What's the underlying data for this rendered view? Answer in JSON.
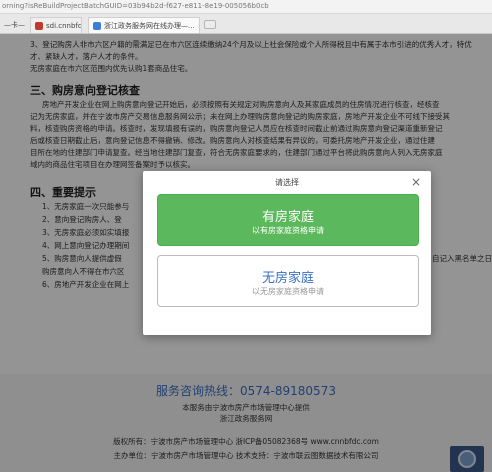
{
  "browser": {
    "url": "orning?isReBuildProjectBatchGUID=03b94b2d-f627-e811-8e19-005056b0cb",
    "tabs": [
      {
        "label": "—卡—"
      },
      {
        "label": "sdi.cnnbfdc.com"
      },
      {
        "label": "浙江政务服务网在线办理—..."
      }
    ]
  },
  "content": {
    "para_lines": [
      "3、登记购房人非市六区户籍的需满足已在市六区连续缴纳24个月及以上社会保险或个人所得税且中有属于本市引进的优秀人才，特优",
      "才、紧缺人才，落户人才的条件。",
      "无房家庭在市六区范围内优先认购1套商品住宅。"
    ],
    "section3_title": "三、购房意向登记核查",
    "section3_lines": [
      "房地产开发企业在网上购房意向登记开始后，必须按照有关规定对购房意向人及其家庭成员的住房情况进行核查，经核查",
      "记为无房家庭，并在宁波市房产交易信息服务网公示；未在网上办理购房意向登记的购房家庭，房地产开发企业不可线下接受其",
      "料，核查购房资格的申请。核查时，发现填报有误的，购房意向登记人员应在核查时间截止前通过购房意向登记渠道重新登记",
      "后或核查日期截止后，意向登记信息不得撤销、修改。购房意向人对核查结果有异议的，可委托房地产开发企业，通过住建",
      "目所在地的住建部门申请复查。经当地住建部门复查，符合无房家庭要求的，住建部门通过平台将此购房意向人列入无房家庭",
      "域内的商品住宅项目在办理网签备案时予以核实。"
    ],
    "section4_title": "四、重要提示",
    "section4_lines": [
      "1、无房家庭一次只能参与",
      "2、意向登记购房人、登",
      "3、无房家庭必须如实填报",
      "4、网上意向登记办理期间",
      "5、购房意向人提供虚假",
      "购房意向人不得在市六区",
      "6、房地产开发企业在网上"
    ],
    "right_fragment": "自记入黑名单之日",
    "footer": {
      "hotline": "服务咨询热线：0574-89180573",
      "provider_line1": "本服务由宁波市房产市场管理中心提供",
      "provider_line2": "浙江政务服务网",
      "copyright": "版权所有：宁波市房产市场管理中心  浙ICP备05082368号 www.cnnbfdc.com",
      "sponsor": "主办单位：宁波市房产市场管理中心  技术支持：宁波市联云图数据技术有限公司"
    }
  },
  "modal": {
    "title": "请选择",
    "close_glyph": "×",
    "option_yes": {
      "title": "有房家庭",
      "subtitle": "以有房家庭资格申请"
    },
    "option_no": {
      "title": "无房家庭",
      "subtitle": "以无房家庭资格申请"
    }
  },
  "colors": {
    "accent_green": "#5cb85c",
    "accent_blue": "#3a6fc4"
  }
}
